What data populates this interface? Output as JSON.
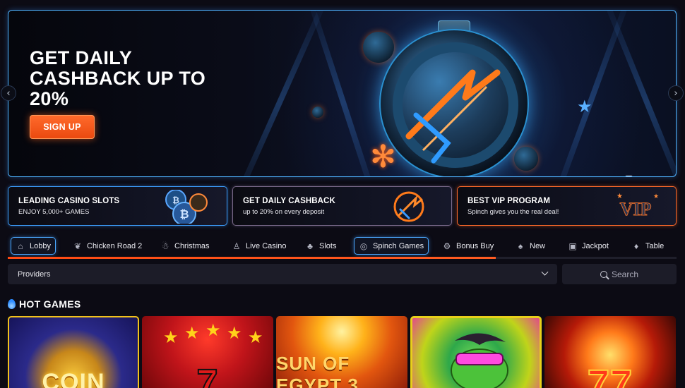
{
  "hero": {
    "title": "GET DAILY CASHBACK UP TO 20%",
    "cta_label": "SIGN UP",
    "prev_icon": "chevron-left-icon",
    "next_icon": "chevron-right-icon",
    "slides_count": 1,
    "active_slide": 1,
    "accent": "#ff5a1a"
  },
  "promos": [
    {
      "title": "LEADING CASINO SLOTS",
      "subtitle": "ENJOY 5,000+ GAMES"
    },
    {
      "title": "GET DAILY CASHBACK",
      "subtitle": "up to 20% on every deposit"
    },
    {
      "title": "BEST VIP PROGRAM",
      "subtitle": "Spinch gives you the real deal!"
    }
  ],
  "categories": [
    {
      "label": "Lobby",
      "icon": "house-icon"
    },
    {
      "label": "Chicken Road 2",
      "icon": "chicken-icon"
    },
    {
      "label": "Christmas",
      "icon": "snowman-icon"
    },
    {
      "label": "Live Casino",
      "icon": "dealer-icon"
    },
    {
      "label": "Slots",
      "icon": "cherries-icon"
    },
    {
      "label": "Spinch Games",
      "icon": "spinch-icon"
    },
    {
      "label": "Bonus Buy",
      "icon": "gear-icon"
    },
    {
      "label": "New",
      "icon": "cards-icon"
    },
    {
      "label": "Jackpot",
      "icon": "jackpot-icon"
    },
    {
      "label": "Table",
      "icon": "table-cards-icon"
    }
  ],
  "scroll_progress": 0.73,
  "filters": {
    "providers_label": "Providers",
    "search_placeholder": "Search"
  },
  "hot_games": {
    "title": "HOT GAMES",
    "games": [
      {
        "text": "COIN"
      },
      {
        "text": "7"
      },
      {
        "text": "SUN OF EGYPT 3"
      },
      {
        "text": ""
      },
      {
        "text": "77"
      }
    ]
  },
  "colors": {
    "background": "#0c0b14",
    "hero_border": "#4fb3ff",
    "brand_orange": "#ff5a1a",
    "selected_border": "#4aa8ff",
    "panel": "#1c1c28"
  }
}
